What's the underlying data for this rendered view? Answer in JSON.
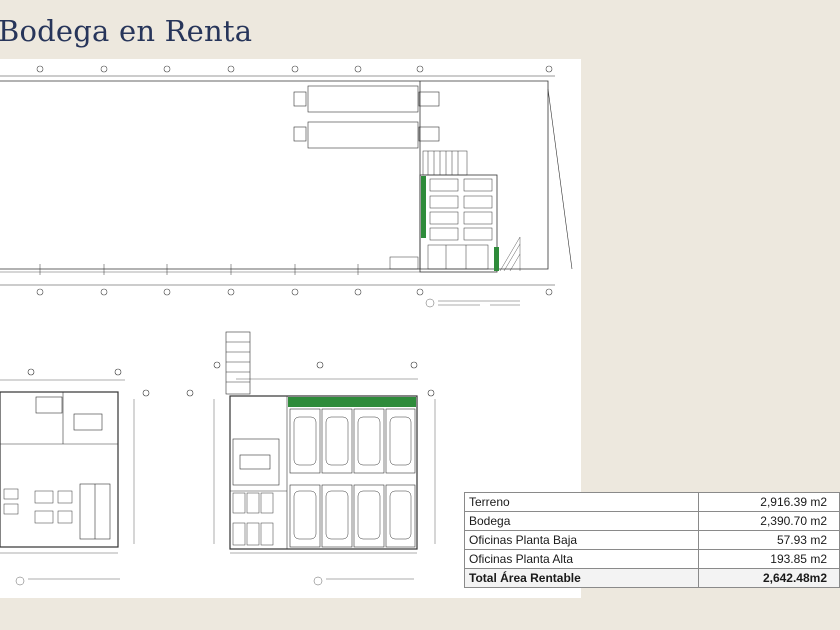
{
  "page": {
    "title": "Bodega en Renta"
  },
  "colors": {
    "title": "#27355a",
    "background": "#ede8de",
    "green_zone": "#2e8b3a"
  },
  "area_table": {
    "rows": [
      {
        "label": "Terreno",
        "value": "2,916.39 m2"
      },
      {
        "label": "Bodega",
        "value": "2,390.70 m2"
      },
      {
        "label": "Oficinas Planta Baja",
        "value": "57.93 m2"
      },
      {
        "label": "Oficinas Planta Alta",
        "value": "193.85 m2"
      }
    ],
    "total": {
      "label": "Total Área Rentable",
      "value": "2,642.48m2"
    }
  }
}
